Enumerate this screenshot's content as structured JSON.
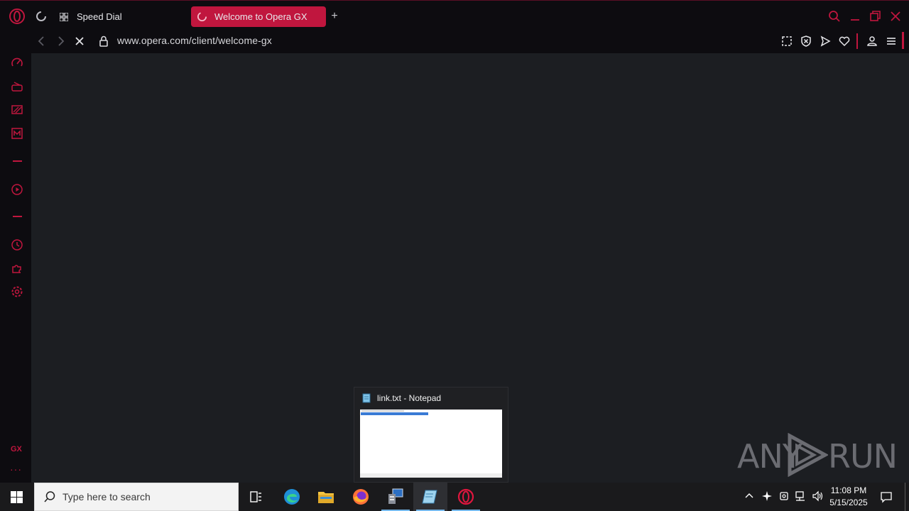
{
  "browser": {
    "accent_color": "#c0163e",
    "tabs": [
      {
        "label": "Speed Dial",
        "icon": "grid-icon",
        "active": false
      },
      {
        "label": "Welcome to Opera GX",
        "icon": "loading-spinner-icon",
        "active": true
      }
    ],
    "url": "www.opera.com/client/welcome-gx",
    "loading": true
  },
  "sidebar": {
    "items": [
      "speedometer-icon",
      "game-controller-icon",
      "twitch-icon",
      "gx-corner-icon",
      "player-icon",
      "history-icon",
      "extensions-icon",
      "settings-icon"
    ],
    "gx_label": "GX",
    "more_label": "···"
  },
  "preview": {
    "title": "link.txt - Notepad"
  },
  "watermark": {
    "text_left": "ANY",
    "text_right": "RUN"
  },
  "taskbar": {
    "search_placeholder": "Type here to search",
    "time": "11:08 PM",
    "date": "5/15/2025"
  }
}
